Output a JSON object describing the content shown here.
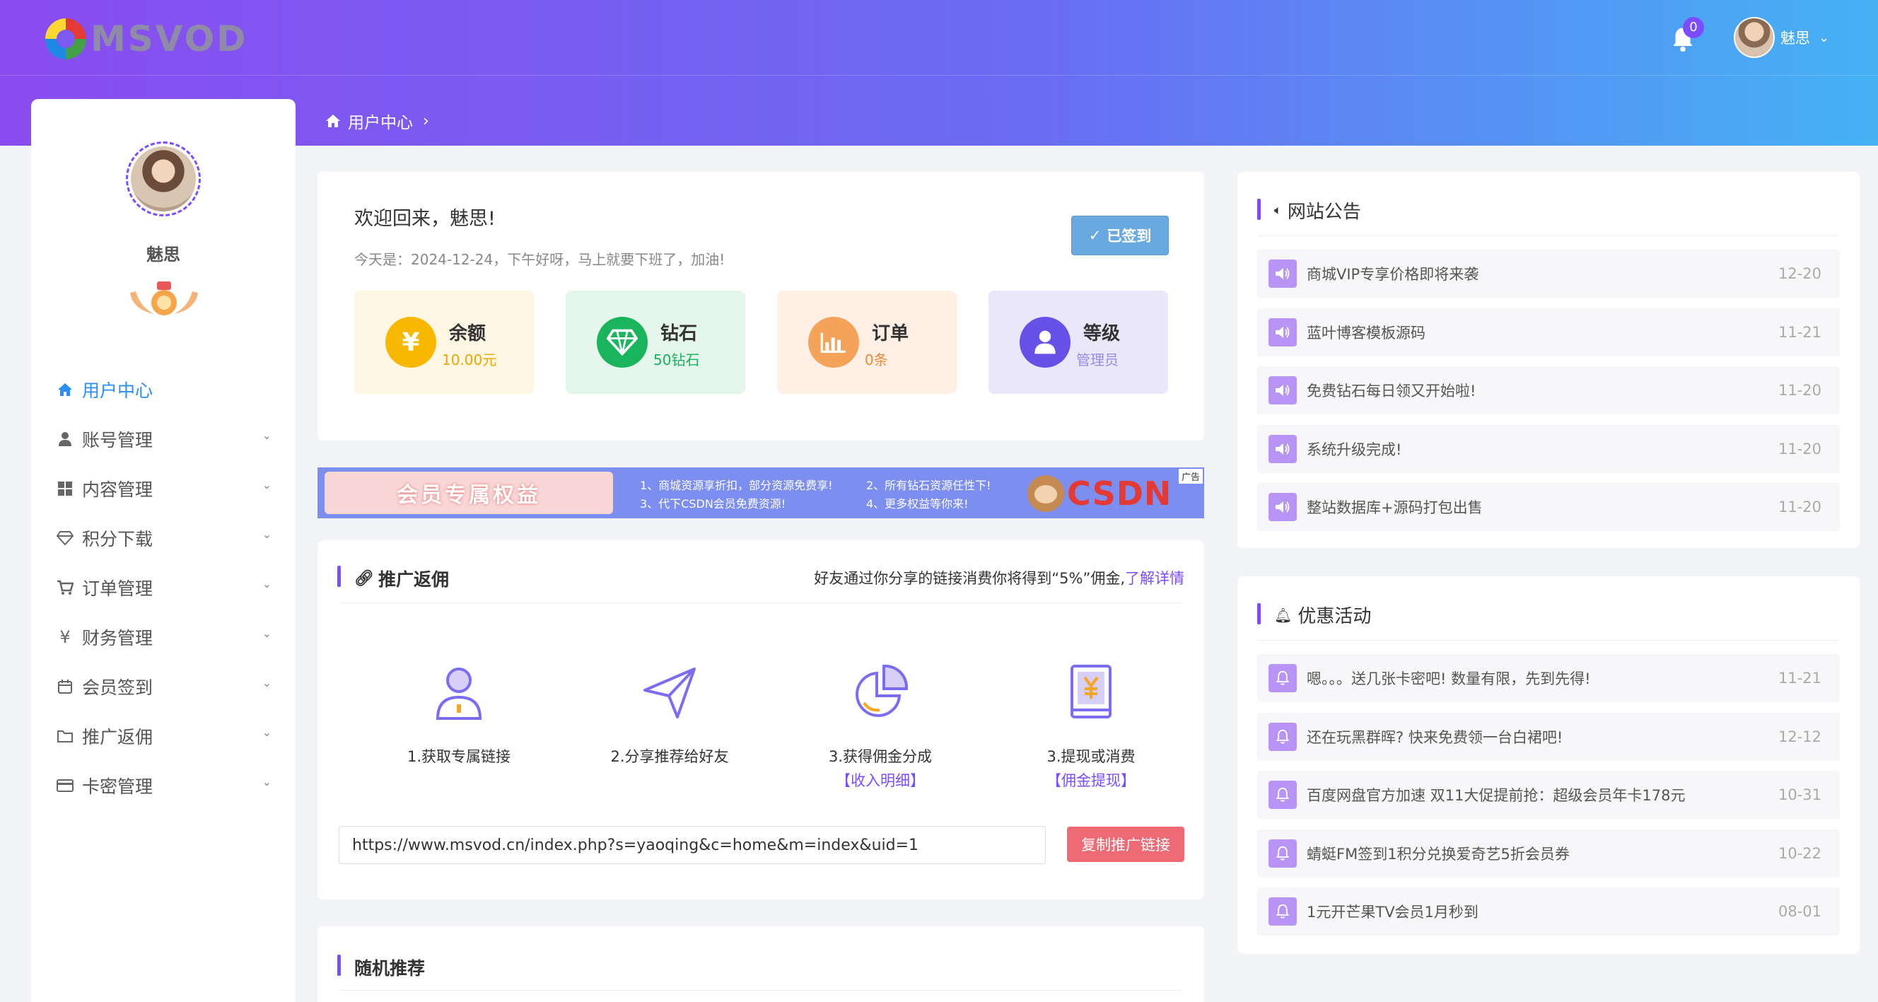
{
  "header": {
    "logo_text": "MSVOD",
    "notification_count": "0",
    "user_name": "魅思"
  },
  "breadcrumb": {
    "current": "用户中心"
  },
  "sidebar": {
    "user_name": "魅思",
    "menu": [
      {
        "label": "用户中心",
        "icon": "home-icon",
        "active": true
      },
      {
        "label": "账号管理",
        "icon": "user-icon"
      },
      {
        "label": "内容管理",
        "icon": "grid-icon"
      },
      {
        "label": "积分下载",
        "icon": "diamond-icon"
      },
      {
        "label": "订单管理",
        "icon": "cart-icon"
      },
      {
        "label": "财务管理",
        "icon": "yen-icon"
      },
      {
        "label": "会员签到",
        "icon": "calendar-icon"
      },
      {
        "label": "推广返佣",
        "icon": "folder-icon"
      },
      {
        "label": "卡密管理",
        "icon": "card-icon"
      }
    ]
  },
  "welcome": {
    "title": "欢迎回来，魅思!",
    "subtitle": "今天是：2024-12-24，下午好呀，马上就要下班了，加油!",
    "sign_button": "已签到",
    "stats": [
      {
        "label": "余额",
        "value": "10.00元",
        "icon": "yen-icon",
        "color": "#f9b800",
        "bg": "#fff6e3",
        "value_color": "#f0a500"
      },
      {
        "label": "钻石",
        "value": "50钻石",
        "icon": "diamond-icon",
        "color": "#19b45c",
        "bg": "#e5f7ec",
        "value_color": "#19b45c"
      },
      {
        "label": "订单",
        "value": "0条",
        "icon": "chart-icon",
        "color": "#f5a25a",
        "bg": "#ffefe4",
        "value_color": "#f08a3a"
      },
      {
        "label": "等级",
        "value": "管理员",
        "icon": "user-icon",
        "color": "#6750e8",
        "bg": "#ebe7fb",
        "value_color": "#9b8ae8"
      }
    ]
  },
  "ad": {
    "left_text": "会员专属权益",
    "lines": [
      "1、商城资源享折扣，部分资源免费享!",
      "2、所有钻石资源任性下!",
      "3、代下CSDN会员免费资源!",
      "4、更多权益等你来!"
    ],
    "brand": "CSDN",
    "tag": "广告"
  },
  "promo": {
    "title": "推广返佣",
    "note": "好友通过你分享的链接消费你将得到“5%”佣金,",
    "note_link": "了解详情",
    "steps": [
      {
        "label": "1.获取专属链接",
        "link": ""
      },
      {
        "label": "2.分享推荐给好友",
        "link": ""
      },
      {
        "label": "3.获得佣金分成",
        "link": "【收入明细】"
      },
      {
        "label": "3.提现或消费",
        "link": "【佣金提现】"
      }
    ],
    "url": "https://www.msvod.cn/index.php?s=yaoqing&c=home&m=index&uid=1",
    "copy_button": "复制推广链接"
  },
  "random": {
    "title": "随机推荐"
  },
  "notice": {
    "title": "网站公告",
    "items": [
      {
        "text": "商城VIP专享价格即将来袭",
        "date": "12-20"
      },
      {
        "text": "蓝叶博客模板源码",
        "date": "11-21"
      },
      {
        "text": "免费钻石每日领又开始啦!",
        "date": "11-20"
      },
      {
        "text": "系统升级完成!",
        "date": "11-20"
      },
      {
        "text": "整站数据库+源码打包出售",
        "date": "11-20"
      }
    ]
  },
  "activity": {
    "title": "优惠活动",
    "items": [
      {
        "text": "嗯。。。送几张卡密吧! 数量有限，先到先得!",
        "date": "11-21"
      },
      {
        "text": "还在玩黑群晖? 快来免费领一台白裙吧!",
        "date": "12-12"
      },
      {
        "text": "百度网盘官方加速 双11大促提前抢：超级会员年卡178元",
        "date": "10-31"
      },
      {
        "text": "蜻蜓FM签到1积分兑换爱奇艺5折会员券",
        "date": "10-22"
      },
      {
        "text": "1元开芒果TV会员1月秒到",
        "date": "08-01"
      }
    ]
  }
}
